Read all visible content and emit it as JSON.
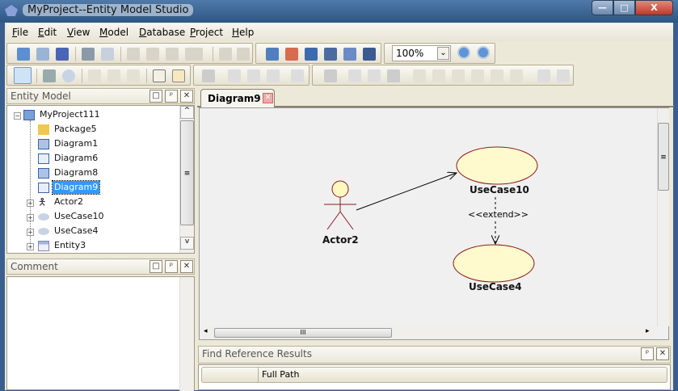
{
  "window": {
    "title": "MyProject--Entity Model Studio",
    "minimize": "—",
    "maximize": "□",
    "close": "X"
  },
  "menu": [
    {
      "label": "File",
      "key": "F",
      "rest": "ile"
    },
    {
      "label": "Edit",
      "key": "E",
      "rest": "dit"
    },
    {
      "label": "View",
      "key": "V",
      "rest": "iew"
    },
    {
      "label": "Model",
      "key": "M",
      "rest": "odel"
    },
    {
      "label": "Database",
      "key": "D",
      "rest": "atabase"
    },
    {
      "label": "Project",
      "key": "P",
      "rest": "roject"
    },
    {
      "label": "Help",
      "key": "H",
      "rest": "elp"
    }
  ],
  "toolbar": {
    "zoom": "100%",
    "zoom_arrow": "⌄"
  },
  "entity_model": {
    "title": "Entity Model",
    "root": "MyProject111",
    "items": [
      "Package5",
      "Diagram1",
      "Diagram6",
      "Diagram8",
      "Diagram9",
      "Actor2",
      "UseCase10",
      "UseCase4",
      "Entity3"
    ],
    "selected": "Diagram9"
  },
  "comment": {
    "title": "Comment"
  },
  "panel_buttons": {
    "max": "□",
    "pin": "ᵖ",
    "close": "✕"
  },
  "editor": {
    "tab": "Diagram9",
    "tab_close": "✕"
  },
  "diagram": {
    "actor": "Actor2",
    "usecase1": "UseCase10",
    "usecase2": "UseCase4",
    "relation": "<<extend>>"
  },
  "scroll": {
    "grip": "III",
    "grip_v": "≡",
    "left": "◂",
    "right": "▸",
    "up": "^",
    "down": "v"
  },
  "find": {
    "title": "Find Reference Results",
    "columns": [
      "",
      "Full Path"
    ]
  }
}
